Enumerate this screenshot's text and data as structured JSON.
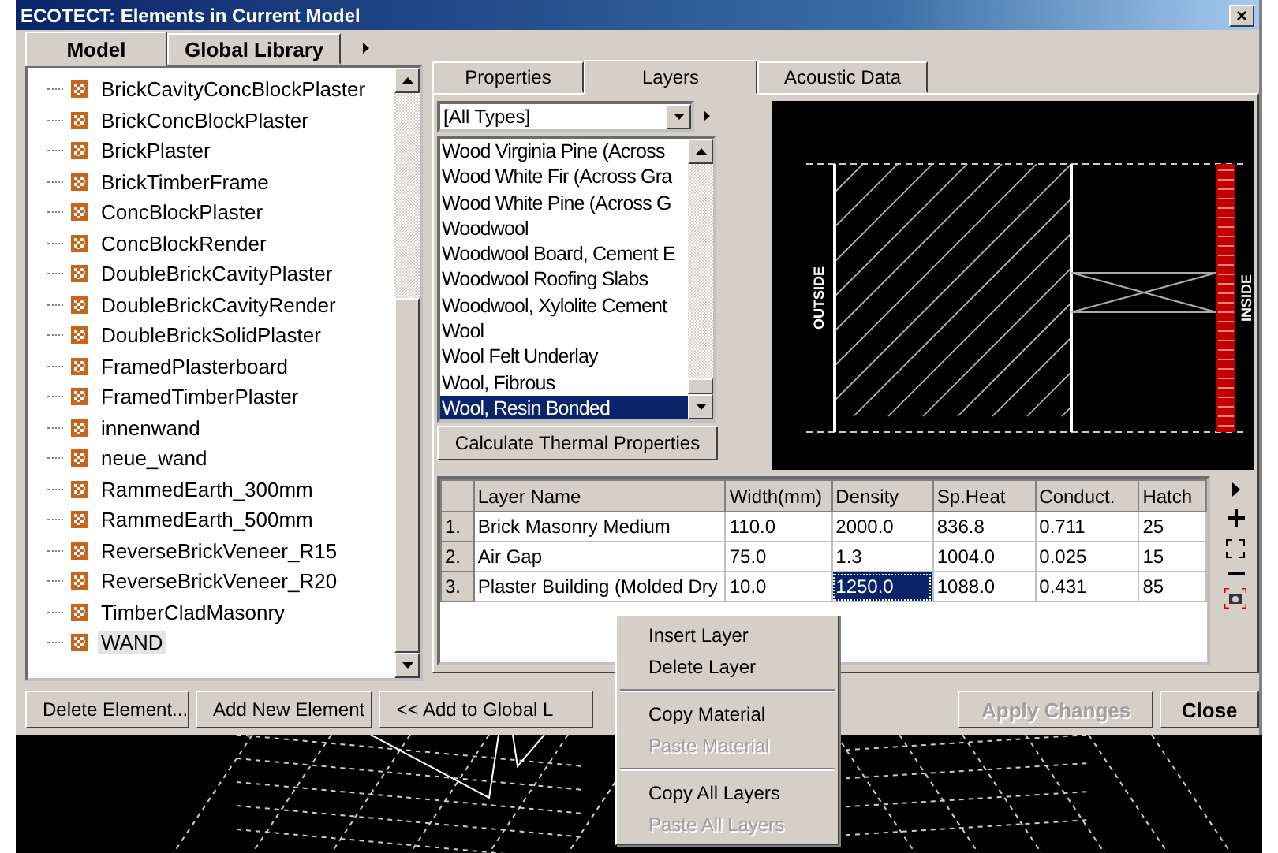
{
  "window": {
    "title": "ECOTECT: Elements in Current Model",
    "close": "×"
  },
  "left_tabs": [
    {
      "label": "Model",
      "selected": true
    },
    {
      "label": "Global Library",
      "selected": false
    }
  ],
  "elements": [
    {
      "name": "BrickCavityConcBlockPlaster",
      "selected": false
    },
    {
      "name": "BrickConcBlockPlaster",
      "selected": false
    },
    {
      "name": "BrickPlaster",
      "selected": false
    },
    {
      "name": "BrickTimberFrame",
      "selected": false
    },
    {
      "name": "ConcBlockPlaster",
      "selected": false
    },
    {
      "name": "ConcBlockRender",
      "selected": false
    },
    {
      "name": "DoubleBrickCavityPlaster",
      "selected": false
    },
    {
      "name": "DoubleBrickCavityRender",
      "selected": false
    },
    {
      "name": "DoubleBrickSolidPlaster",
      "selected": false
    },
    {
      "name": "FramedPlasterboard",
      "selected": false
    },
    {
      "name": "FramedTimberPlaster",
      "selected": false
    },
    {
      "name": "innenwand",
      "selected": false
    },
    {
      "name": "neue_wand",
      "selected": false
    },
    {
      "name": "RammedEarth_300mm",
      "selected": false
    },
    {
      "name": "RammedEarth_500mm",
      "selected": false
    },
    {
      "name": "ReverseBrickVeneer_R15",
      "selected": false
    },
    {
      "name": "ReverseBrickVeneer_R20",
      "selected": false
    },
    {
      "name": "TimberCladMasonry",
      "selected": false
    },
    {
      "name": "WAND",
      "selected": true
    }
  ],
  "right_tabs": [
    {
      "label": "Properties",
      "selected": false
    },
    {
      "label": "Layers",
      "selected": true
    },
    {
      "label": "Acoustic Data",
      "selected": false
    }
  ],
  "type_filter": {
    "value": "[All Types]"
  },
  "materials": [
    {
      "name": "Wood Virginia Pine (Across",
      "selected": false
    },
    {
      "name": "Wood White Fir (Across Gra",
      "selected": false
    },
    {
      "name": "Wood White Pine (Across G",
      "selected": false
    },
    {
      "name": "Woodwool",
      "selected": false
    },
    {
      "name": "Woodwool Board, Cement E",
      "selected": false
    },
    {
      "name": "Woodwool Roofing Slabs",
      "selected": false
    },
    {
      "name": "Woodwool, Xylolite Cement",
      "selected": false
    },
    {
      "name": "Wool",
      "selected": false
    },
    {
      "name": "Wool Felt Underlay",
      "selected": false
    },
    {
      "name": "Wool, Fibrous",
      "selected": false
    },
    {
      "name": "Wool, Resin Bonded",
      "selected": true
    }
  ],
  "calculate_button": "Calculate Thermal Properties",
  "section": {
    "outside_label": "OUTSIDE",
    "inside_label": "INSIDE"
  },
  "layers_table": {
    "columns": [
      "Layer Name",
      "Width(mm)",
      "Density",
      "Sp.Heat",
      "Conduct.",
      "Hatch"
    ],
    "rows": [
      {
        "index": "1.",
        "cells": [
          {
            "text": "Brick Masonry Medium",
            "selected": false
          },
          {
            "text": "110.0",
            "selected": false
          },
          {
            "text": "2000.0",
            "selected": false
          },
          {
            "text": "836.8",
            "selected": false
          },
          {
            "text": "0.711",
            "selected": false
          },
          {
            "text": "25",
            "selected": false
          }
        ]
      },
      {
        "index": "2.",
        "cells": [
          {
            "text": "Air Gap",
            "selected": false
          },
          {
            "text": "75.0",
            "selected": false
          },
          {
            "text": "1.3",
            "selected": false
          },
          {
            "text": "1004.0",
            "selected": false
          },
          {
            "text": "0.025",
            "selected": false
          },
          {
            "text": "15",
            "selected": false
          }
        ]
      },
      {
        "index": "3.",
        "cells": [
          {
            "text": "Plaster Building (Molded Dry",
            "selected": false
          },
          {
            "text": "10.0",
            "selected": false
          },
          {
            "text": "1250.0",
            "selected": true
          },
          {
            "text": "1088.0",
            "selected": false
          },
          {
            "text": "0.431",
            "selected": false
          },
          {
            "text": "85",
            "selected": false
          }
        ]
      }
    ]
  },
  "buttons": [
    {
      "label": "Delete Element...",
      "disabled": false
    },
    {
      "label": "Add New Element",
      "disabled": false
    },
    {
      "label": "<< Add to Global L",
      "disabled": false
    },
    {
      "label": "Apply Changes",
      "disabled": true
    },
    {
      "label": "Close",
      "disabled": false
    }
  ],
  "context_menu": [
    {
      "kind": "item",
      "label": "Insert Layer",
      "disabled": false
    },
    {
      "kind": "item",
      "label": "Delete Layer",
      "disabled": false
    },
    {
      "kind": "separator"
    },
    {
      "kind": "item",
      "label": "Copy Material",
      "disabled": false
    },
    {
      "kind": "item",
      "label": "Paste Material",
      "disabled": true
    },
    {
      "kind": "separator"
    },
    {
      "kind": "item",
      "label": "Copy All Layers",
      "disabled": false
    },
    {
      "kind": "item",
      "label": "Paste All Layers",
      "disabled": true
    }
  ]
}
